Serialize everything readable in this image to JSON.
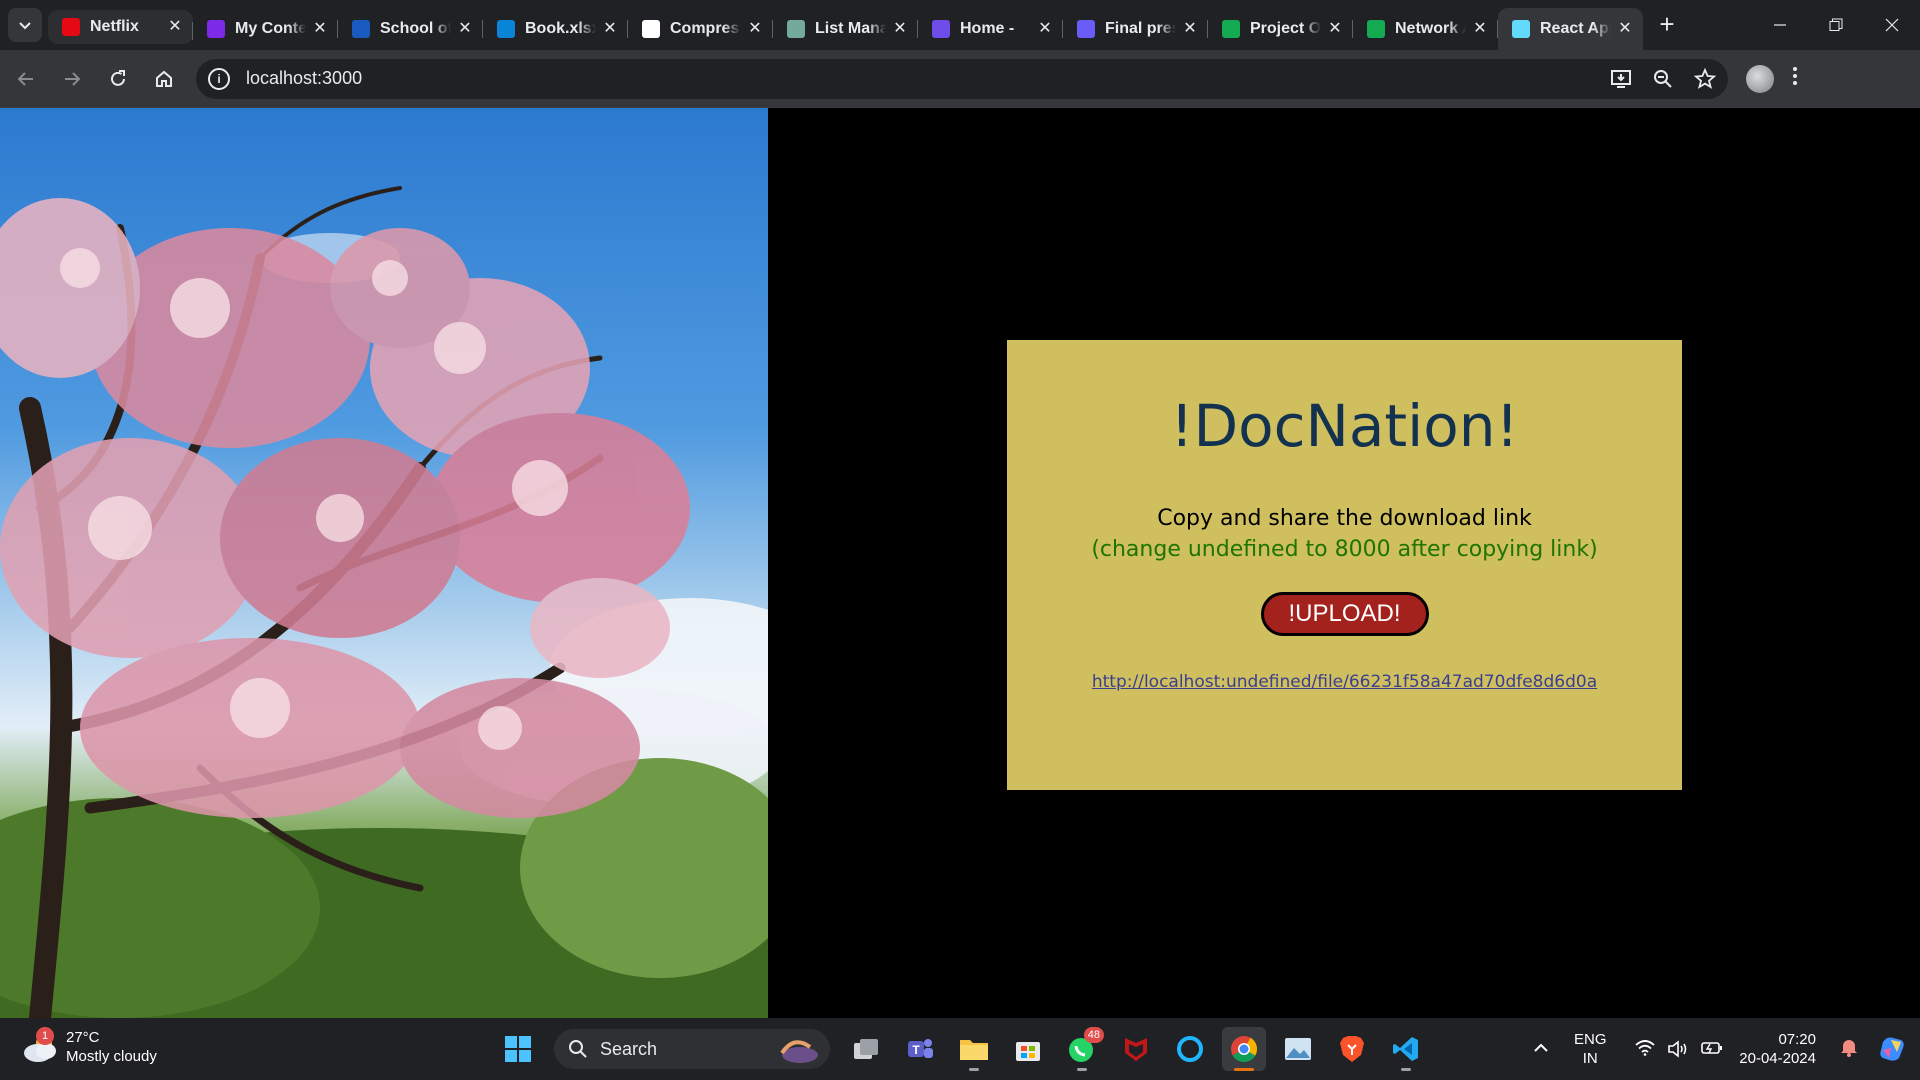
{
  "browser": {
    "tabs": [
      {
        "title": "Netflix",
        "favicon": "netflix-icon",
        "color": "#e50914"
      },
      {
        "title": "My Content",
        "favicon": "canva-icon",
        "color": "#7d2ae8"
      },
      {
        "title": "School of",
        "favicon": "word-icon",
        "color": "#185abd"
      },
      {
        "title": "Book.xlsx",
        "favicon": "onedrive-icon",
        "color": "#0a84d6"
      },
      {
        "title": "Compressor",
        "favicon": "chart-icon",
        "color": "#ffffff"
      },
      {
        "title": "List Manager",
        "favicon": "chatgpt-icon",
        "color": "#74aa9c"
      },
      {
        "title": "Home -",
        "favicon": "canva-c-icon",
        "color": "#6d4ce8"
      },
      {
        "title": "Final presentation",
        "favicon": "copilot-icon",
        "color": "#6a5cf6"
      },
      {
        "title": "Project Overview",
        "favicon": "mongodb-icon",
        "color": "#13aa52"
      },
      {
        "title": "Network Access",
        "favicon": "mongodb-icon",
        "color": "#13aa52"
      },
      {
        "title": "React App",
        "favicon": "react-icon",
        "color": "#61dafb"
      }
    ],
    "active_tab_index": 10,
    "address": "localhost:3000"
  },
  "app": {
    "heading": "!DocNation!",
    "instruction": "Copy and share the download link",
    "note": "(change undefined to 8000 after copying link)",
    "upload_label": "!UPLOAD!",
    "download_link": "http://localhost:undefined/file/66231f58a47ad70dfe8d6d0a"
  },
  "taskbar": {
    "weather": {
      "temp": "27°C",
      "condition": "Mostly cloudy",
      "badge": "1"
    },
    "search_placeholder": "Search",
    "whatsapp_badge": "48",
    "lang_line1": "ENG",
    "lang_line2": "IN",
    "time": "07:20",
    "date": "20-04-2024"
  },
  "colors": {
    "card": "#cfbf5f",
    "heading": "#13324f",
    "note": "#1f7400",
    "button": "#a3221e"
  }
}
